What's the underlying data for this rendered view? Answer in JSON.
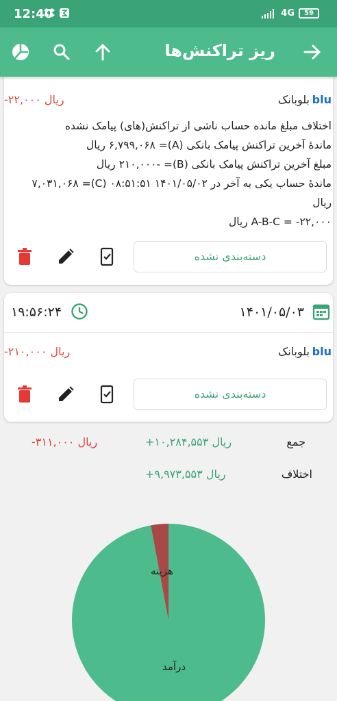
{
  "status": {
    "time": "12:40",
    "network": "4G",
    "battery": "59"
  },
  "appbar": {
    "title": "ریز تراکنش‌ها",
    "icons": [
      "arrow-forward-icon",
      "arrow-up-icon",
      "search-icon",
      "pie-chart-icon"
    ]
  },
  "transactions": [
    {
      "bank_logo": "blu",
      "bank_name": "بلوبانک",
      "amount": "-۲۲,۰۰۰ ریال",
      "description": [
        "اختلاف مبلغ مانده حساب ناشی از تراکنش(های) پیامک نشده",
        "ماندهٔ آخرین تراکنش پیامک بانکی (A)= ۶,۷۹۹,۰۶۸ ریال",
        "مبلغ آخرین تراکنش پیامک بانکی (B)= -۲۱۰,۰۰۰ ریال",
        "ماندهٔ حساب یکی به آخر در ۱۴۰۱/۰۵/۰۲ ۰۸:۵۱:۵۱ (C)= ۷,۰۳۱,۰۶۸",
        "ریال",
        "A-B-C = -۲۲,۰۰۰ ریال"
      ],
      "category_label": "دسته‌بندی نشده"
    },
    {
      "date": "۱۴۰۱/۰۵/۰۳",
      "time": "۱۹:۵۶:۲۴",
      "bank_logo": "blu",
      "bank_name": "بلوبانک",
      "amount": "-۲۱۰,۰۰۰ ریال",
      "category_label": "دسته‌بندی نشده"
    }
  ],
  "summary": {
    "total_label": "جمع",
    "total_income": "+۱۰,۲۸۴,۵۵۳ ریال",
    "total_expense": "-۳۱۱,۰۰۰ ریال",
    "diff_label": "اختلاف",
    "diff_value": "+۹,۹۷۳,۵۵۳ ریال"
  },
  "pie": {
    "income_label": "درآمد",
    "expense_label": "هزینه",
    "income_color": "#4dbb8b",
    "expense_color": "#a94848",
    "income_value": 10284553,
    "expense_value": 311000
  },
  "colors": {
    "accent": "#4dbb8b",
    "status_bar": "#3aa477",
    "negative": "#d9453d",
    "bank_blue": "#1a6fc7"
  }
}
